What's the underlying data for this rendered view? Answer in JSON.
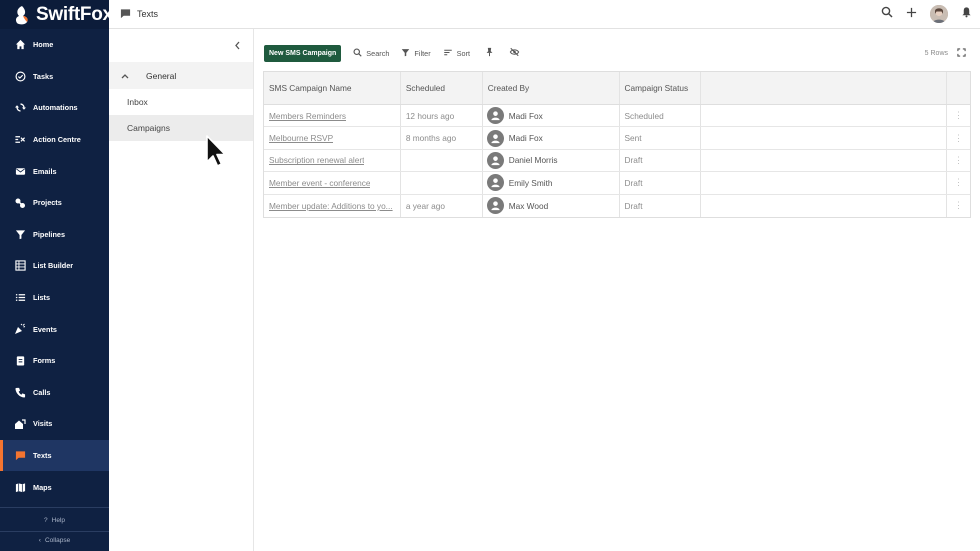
{
  "brand": {
    "name": "SwiftFox"
  },
  "colors": {
    "sidebar_bg": "#0f2142",
    "active_accent": "#f37430",
    "primary_button": "#1f5a3e"
  },
  "sidebar": {
    "items": [
      {
        "label": "Home",
        "icon": "home-icon"
      },
      {
        "label": "Tasks",
        "icon": "check-circle-icon"
      },
      {
        "label": "Automations",
        "icon": "sync-icon"
      },
      {
        "label": "Action Centre",
        "icon": "action-centre-icon"
      },
      {
        "label": "Emails",
        "icon": "mail-icon"
      },
      {
        "label": "Projects",
        "icon": "projects-icon"
      },
      {
        "label": "Pipelines",
        "icon": "funnel-icon"
      },
      {
        "label": "List Builder",
        "icon": "list-builder-icon"
      },
      {
        "label": "Lists",
        "icon": "lists-icon"
      },
      {
        "label": "Events",
        "icon": "events-icon"
      },
      {
        "label": "Forms",
        "icon": "clipboard-icon"
      },
      {
        "label": "Calls",
        "icon": "phone-icon"
      },
      {
        "label": "Visits",
        "icon": "visits-icon"
      },
      {
        "label": "Texts",
        "icon": "chat-icon",
        "active": true
      },
      {
        "label": "Maps",
        "icon": "map-icon"
      }
    ],
    "help_label": "Help",
    "collapse_label": "Collapse"
  },
  "topbar": {
    "title": "Texts"
  },
  "panel": {
    "group_label": "General",
    "items": [
      "Inbox",
      "Campaigns"
    ],
    "selected": "Campaigns"
  },
  "toolbar": {
    "new_button": "New SMS Campaign",
    "search": "Search",
    "filter": "Filter",
    "sort": "Sort",
    "rows_info": "5 Rows"
  },
  "table": {
    "columns": [
      "SMS Campaign Name",
      "Scheduled",
      "Created By",
      "Campaign Status"
    ],
    "rows": [
      {
        "name": "Members Reminders",
        "scheduled": "12 hours ago",
        "created_by": "Madi Fox",
        "status": "Scheduled"
      },
      {
        "name": "Melbourne RSVP",
        "scheduled": "8 months ago",
        "created_by": "Madi Fox",
        "status": "Sent"
      },
      {
        "name": "Subscription renewal alert",
        "scheduled": "",
        "created_by": "Daniel Morris",
        "status": "Draft"
      },
      {
        "name": "Member event - conference",
        "scheduled": "",
        "created_by": "Emily Smith",
        "status": "Draft"
      },
      {
        "name": "Member update: Additions to yo...",
        "scheduled": "a year ago",
        "created_by": "Max Wood",
        "status": "Draft"
      }
    ]
  }
}
